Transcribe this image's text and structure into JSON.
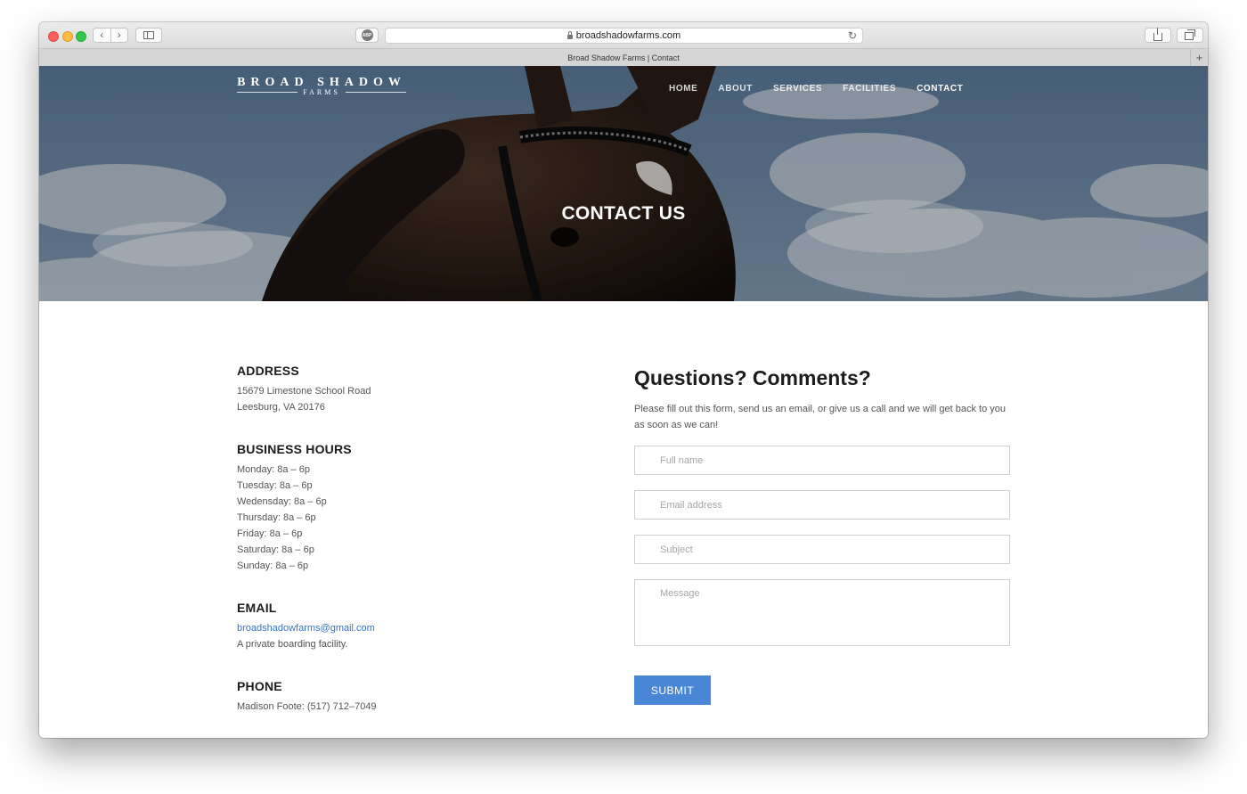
{
  "browser": {
    "url": "broadshadowfarms.com",
    "tab_title": "Broad Shadow Farms | Contact",
    "back_glyph": "‹",
    "forward_glyph": "›",
    "adblock_label": "ABP",
    "reload_glyph": "↻",
    "new_tab_glyph": "+"
  },
  "site": {
    "logo_main": "BROAD SHADOW",
    "logo_sub": "FARMS",
    "nav": [
      {
        "label": "HOME"
      },
      {
        "label": "ABOUT"
      },
      {
        "label": "SERVICES"
      },
      {
        "label": "FACILITIES"
      },
      {
        "label": "CONTACT",
        "active": true
      }
    ],
    "hero_title": "CONTACT US"
  },
  "info": {
    "address_heading": "ADDRESS",
    "address_line1": "15679 Limestone School Road",
    "address_line2": "Leesburg, VA 20176",
    "hours_heading": "BUSINESS HOURS",
    "hours": [
      "Monday: 8a – 6p",
      "Tuesday: 8a – 6p",
      "Wedensday: 8a – 6p",
      "Thursday: 8a – 6p",
      "Friday: 8a – 6p",
      "Saturday: 8a – 6p",
      "Sunday: 8a – 6p"
    ],
    "email_heading": "EMAIL",
    "email": "broadshadowfarms@gmail.com",
    "email_note": "A private boarding facility.",
    "phone_heading": "PHONE",
    "phone": "Madison Foote: (517) 712–7049"
  },
  "form": {
    "heading": "Questions? Comments?",
    "intro": "Please fill out this form, send us an email, or give us a call and we will get back to you as soon as we can!",
    "name_placeholder": "Full name",
    "email_placeholder": "Email address",
    "subject_placeholder": "Subject",
    "message_placeholder": "Message",
    "submit_label": "SUBMIT"
  },
  "colors": {
    "accent": "#4a86d6",
    "link": "#3a73c4",
    "heading": "#1c1c1c",
    "body_text": "#555555"
  }
}
